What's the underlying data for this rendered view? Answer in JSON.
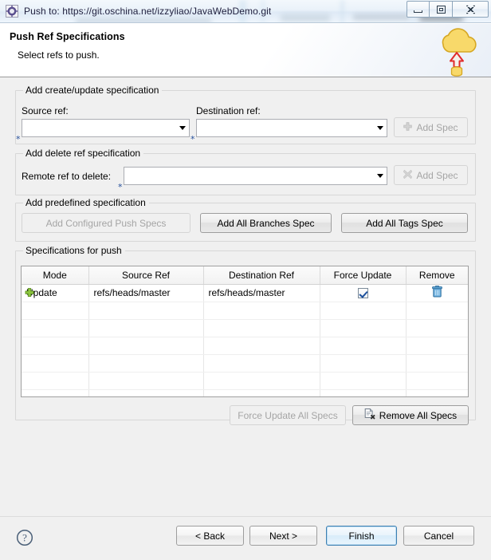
{
  "window": {
    "title": "Push to: https://git.oschina.net/izzyliao/JavaWebDemo.git",
    "icon": "push-wizard-icon",
    "controls": {
      "minimize": "minimize-button",
      "restore": "restore-button",
      "close": "✕"
    }
  },
  "header": {
    "title": "Push Ref Specifications",
    "subtitle": "Select refs to push.",
    "icon": "cloud-upload-icon"
  },
  "create_update_group": {
    "title": "Add create/update specification",
    "source_label": "Source ref:",
    "source_value": "",
    "destination_label": "Destination ref:",
    "destination_value": "",
    "add_spec_label": "Add Spec",
    "add_spec_icon": "plus-icon",
    "add_spec_enabled": false,
    "required_marker": "*"
  },
  "delete_group": {
    "title": "Add delete ref specification",
    "remote_label": "Remote ref to delete:",
    "remote_value": "",
    "add_spec_label": "Add Spec",
    "add_spec_icon": "cross-icon",
    "add_spec_enabled": false,
    "required_marker": "*"
  },
  "predefined_group": {
    "title": "Add predefined specification",
    "buttons": [
      {
        "label": "Add Configured Push Specs",
        "enabled": false
      },
      {
        "label": "Add All Branches Spec",
        "enabled": true
      },
      {
        "label": "Add All Tags Spec",
        "enabled": true
      }
    ]
  },
  "specs_group": {
    "title": "Specifications for push",
    "columns": [
      "Mode",
      "Source Ref",
      "Destination Ref",
      "Force Update",
      "Remove"
    ],
    "rows": [
      {
        "mode_icon": "green-plus-icon",
        "mode": "Update",
        "source_ref": "refs/heads/master",
        "destination_ref": "refs/heads/master",
        "force_update": true,
        "remove_icon": "trash-icon"
      }
    ],
    "empty_row_count": 7,
    "force_update_all_label": "Force Update All Specs",
    "force_update_all_enabled": false,
    "remove_all_label": "Remove All Specs",
    "remove_all_icon": "remove-all-icon",
    "remove_all_enabled": true
  },
  "footer": {
    "help_icon": "help-icon",
    "back_label": "< Back",
    "next_label": "Next >",
    "finish_label": "Finish",
    "cancel_label": "Cancel",
    "default_button": "Finish"
  },
  "colors": {
    "accent_blue": "#3c7fb1",
    "cloud_yellow": "#f7d257",
    "arrow_red": "#e03131",
    "green_plus": "#7cb342",
    "trash_blue": "#5b9bd5",
    "required_star": "#27509b"
  }
}
